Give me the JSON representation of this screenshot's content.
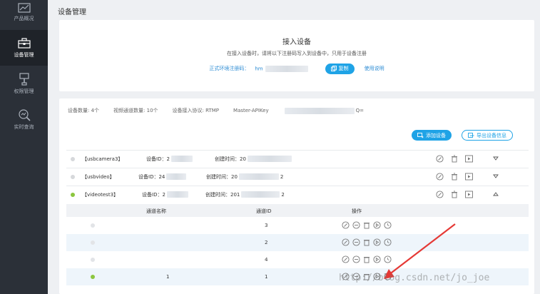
{
  "sidebar": {
    "items": [
      {
        "label": "产品概况",
        "icon": "chart-icon",
        "active": false
      },
      {
        "label": "设备管理",
        "icon": "briefcase-icon",
        "active": true
      },
      {
        "label": "权限管理",
        "icon": "stamp-icon",
        "active": false
      },
      {
        "label": "实时查询",
        "icon": "magnifier-icon",
        "active": false
      }
    ]
  },
  "page": {
    "title": "设备管理"
  },
  "access": {
    "title": "接入设备",
    "description": "在接入设备时，请将以下注册码写入到设备中，只用于设备注册",
    "reg_label": "正式环境注册码：",
    "reg_code_prefix": "hm",
    "copy_label": "复制",
    "help_label": "使用说明"
  },
  "stats": {
    "device_count": "设备数量: 4个",
    "channel_count": "视频通道数量: 10个",
    "protocol": "设备接入协议: RTMP",
    "api_key_prefix": "Master-APIKey",
    "api_key_suffix": "Q="
  },
  "toolbar": {
    "add_label": "添加设备",
    "export_label": "导出设备信息"
  },
  "devices": [
    {
      "name": "【usbcamera3】",
      "id_label": "设备ID：2",
      "time_label": "创建时间：20",
      "time_tail": "",
      "online": false,
      "expanded": false
    },
    {
      "name": "【usbvideo】",
      "id_label": "设备ID：24",
      "time_label": "创建时间：20",
      "time_tail": "2",
      "online": false,
      "expanded": false
    },
    {
      "name": "【videotest3】",
      "id_label": "设备ID：2",
      "time_label": "创建时间：201",
      "time_tail": "2",
      "online": true,
      "expanded": true
    }
  ],
  "channel_table": {
    "headers": [
      "通道名称",
      "通道ID",
      "操作"
    ],
    "rows": [
      {
        "name": "",
        "id": "3",
        "online": false
      },
      {
        "name": "",
        "id": "2",
        "online": false
      },
      {
        "name": "",
        "id": "4",
        "online": false
      },
      {
        "name": "1",
        "id": "1",
        "online": true
      }
    ]
  },
  "watermark": "http://blog.csdn.net/jo_joe",
  "colors": {
    "accent": "#1fa3e6",
    "sidebar": "#2b3038",
    "online": "#8cc63f",
    "arrow": "#e53935"
  }
}
